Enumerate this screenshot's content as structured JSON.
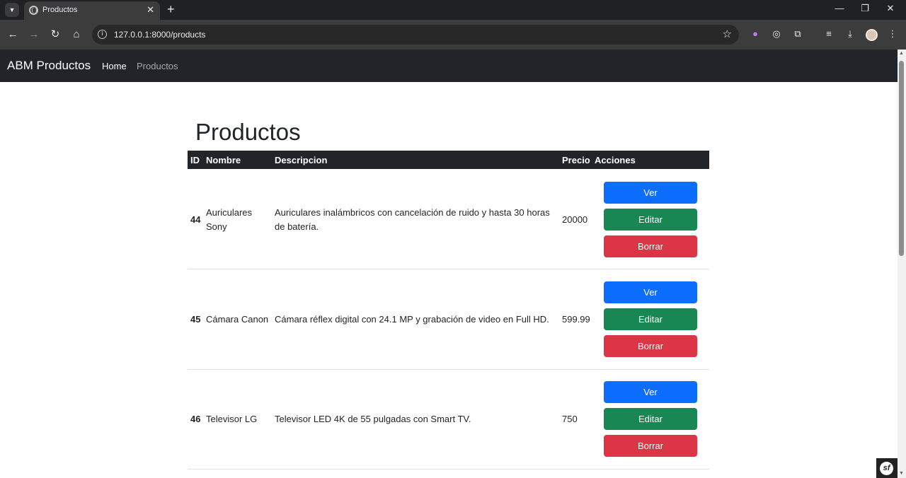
{
  "browser": {
    "tab_title": "Productos",
    "url": "127.0.0.1:8000/products",
    "tab_close_glyph": "✕",
    "new_tab_glyph": "+",
    "icons": [
      "tab-list-icon",
      "globe-icon",
      "close-icon",
      "plus-icon",
      "minimize-icon",
      "restore-icon",
      "back-icon",
      "forward-icon",
      "reload-icon",
      "home-icon",
      "info-icon",
      "star-icon",
      "extension-icon",
      "download-icon",
      "menu-icon"
    ]
  },
  "navbar": {
    "brand": "ABM Productos",
    "links": [
      {
        "label": "Home",
        "active": true
      },
      {
        "label": "Productos",
        "active": false
      }
    ]
  },
  "page": {
    "title": "Productos"
  },
  "table": {
    "headers": [
      "ID",
      "Nombre",
      "Descripcion",
      "Precio",
      "Acciones"
    ],
    "rows": [
      {
        "id": "44",
        "name_line1": "Auriculares",
        "name_line2": "Sony",
        "desc_line1": "Auriculares inalámbricos con cancelación de ruido y hasta 30 horas",
        "desc_line2": "de batería.",
        "price": "20000"
      },
      {
        "id": "45",
        "name_line1": "Cámara Canon",
        "name_line2": "",
        "desc_line1": "Cámara réflex digital con 24.1 MP y grabación de video en Full HD.",
        "desc_line2": "",
        "price": "599.99"
      },
      {
        "id": "46",
        "name_line1": "Televisor LG",
        "name_line2": "",
        "desc_line1": "Televisor LED 4K de 55 pulgadas con Smart TV.",
        "desc_line2": "",
        "price": "750"
      }
    ],
    "actions": {
      "view": "Ver",
      "edit": "Editar",
      "delete": "Borrar"
    }
  },
  "colors": {
    "navbar": "#212529",
    "primary": "#0d6efd",
    "success": "#198754",
    "danger": "#dc3545"
  }
}
